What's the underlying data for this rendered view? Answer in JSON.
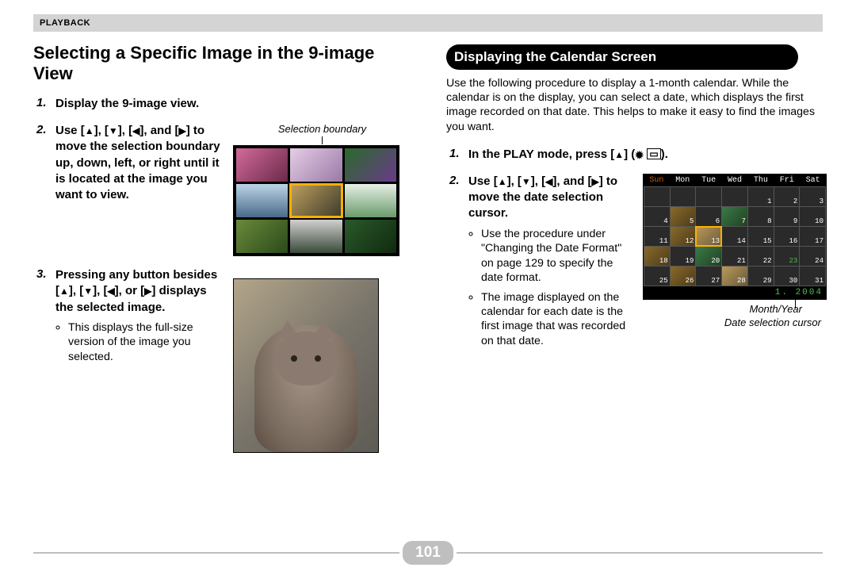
{
  "header": "PLAYBACK",
  "page_number": "101",
  "left": {
    "title": "Selecting a Specific Image in the 9-image View",
    "step1": "Display the 9-image view.",
    "step2_pre": "Use ",
    "step2_post": " to move the selection boundary up, down, left, or right until it is located at the image you want to view.",
    "step3_pre": "Pressing any button besides ",
    "step3_post": " displays the selected image.",
    "step3_bullet": "This displays the full-size version of the image you selected.",
    "caption": "Selection boundary"
  },
  "right": {
    "heading": "Displaying the Calendar Screen",
    "intro": "Use the following procedure to display a 1-month calendar. While the calendar is on the display, you can select a date, which displays the first image recorded on that date. This helps to make it easy to find the images you want.",
    "step1_pre": "In the PLAY mode, press ",
    "step1_post": ".",
    "step2_pre": "Use ",
    "step2_post": " to move the date selection cursor.",
    "bullet1": "Use the procedure under \"Changing the Date Format\" on page 129 to specify the date format.",
    "bullet2": "The image displayed on the calendar for each date is the first image that was recorded on that date.",
    "cal_caption1": "Month/Year",
    "cal_caption2": "Date selection cursor",
    "cal_days": [
      "Sun",
      "Mon",
      "Tue",
      "Wed",
      "Thu",
      "Fri",
      "Sat"
    ],
    "cal_month_year": "1. 2004"
  }
}
